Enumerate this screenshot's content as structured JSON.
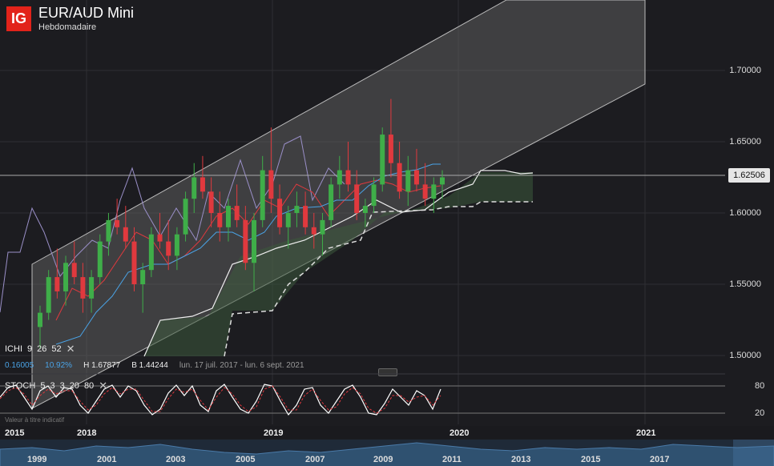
{
  "header": {
    "logo": "IG",
    "title": "EUR/AUD Mini",
    "subtitle": "Hebdomadaire"
  },
  "price_axis": {
    "ticks": [
      "1.70000",
      "1.65000",
      "1.60000",
      "1.55000",
      "1.50000"
    ],
    "current_price": "1.62506"
  },
  "ichimoku": {
    "label": "ICHI",
    "params": [
      "9",
      "26",
      "52"
    ],
    "close_icon": "close-icon",
    "change": "0.16005",
    "change_pct": "10.92%",
    "high": "H 1.67877",
    "low": "B 1.44244",
    "range": "lun. 17 juil. 2017 - lun. 6 sept. 2021"
  },
  "stochastic": {
    "label": "STOCH",
    "params": [
      "5",
      "3",
      "3",
      "20",
      "80"
    ],
    "close_icon": "close-icon",
    "note": "Valeur à titre indicatif",
    "levels": [
      "80",
      "20"
    ]
  },
  "time_axis": [
    "2015",
    "2018",
    "2019",
    "2020",
    "2021"
  ],
  "navigator_axis": [
    "1999",
    "2001",
    "2003",
    "2005",
    "2007",
    "2009",
    "2011",
    "2013",
    "2015",
    "2017"
  ],
  "colors": {
    "up": "#3fae49",
    "down": "#e0393e",
    "channel": "#8a8a8a",
    "cloud": "#3c4a3c",
    "tenkan": "#e0393e",
    "kijun": "#4aa3e6",
    "chikou": "#9a8fc8",
    "senkou": "#ffffff"
  },
  "chart_data": {
    "type": "candlestick",
    "period": "weekly",
    "ylim": [
      1.475,
      1.725
    ],
    "ohlc": [
      [
        1.52,
        1.535,
        1.505,
        1.53
      ],
      [
        1.53,
        1.56,
        1.525,
        1.555
      ],
      [
        1.555,
        1.575,
        1.54,
        1.545
      ],
      [
        1.545,
        1.57,
        1.535,
        1.565
      ],
      [
        1.565,
        1.58,
        1.55,
        1.555
      ],
      [
        1.555,
        1.565,
        1.53,
        1.54
      ],
      [
        1.54,
        1.56,
        1.53,
        1.555
      ],
      [
        1.555,
        1.585,
        1.55,
        1.58
      ],
      [
        1.58,
        1.6,
        1.57,
        1.595
      ],
      [
        1.595,
        1.61,
        1.585,
        1.59
      ],
      [
        1.59,
        1.605,
        1.575,
        1.58
      ],
      [
        1.58,
        1.59,
        1.545,
        1.55
      ],
      [
        1.55,
        1.565,
        1.53,
        1.56
      ],
      [
        1.56,
        1.59,
        1.555,
        1.585
      ],
      [
        1.585,
        1.6,
        1.575,
        1.58
      ],
      [
        1.58,
        1.595,
        1.56,
        1.57
      ],
      [
        1.57,
        1.59,
        1.56,
        1.585
      ],
      [
        1.585,
        1.615,
        1.58,
        1.61
      ],
      [
        1.61,
        1.635,
        1.6,
        1.625
      ],
      [
        1.625,
        1.64,
        1.61,
        1.615
      ],
      [
        1.615,
        1.625,
        1.59,
        1.6
      ],
      [
        1.6,
        1.615,
        1.58,
        1.59
      ],
      [
        1.59,
        1.61,
        1.58,
        1.605
      ],
      [
        1.605,
        1.62,
        1.59,
        1.595
      ],
      [
        1.595,
        1.605,
        1.56,
        1.565
      ],
      [
        1.565,
        1.6,
        1.545,
        1.595
      ],
      [
        1.595,
        1.64,
        1.59,
        1.63
      ],
      [
        1.63,
        1.66,
        1.6,
        1.61
      ],
      [
        1.61,
        1.62,
        1.585,
        1.59
      ],
      [
        1.59,
        1.605,
        1.575,
        1.6
      ],
      [
        1.6,
        1.615,
        1.59,
        1.605
      ],
      [
        1.605,
        1.615,
        1.585,
        1.59
      ],
      [
        1.59,
        1.6,
        1.575,
        1.585
      ],
      [
        1.585,
        1.6,
        1.57,
        1.595
      ],
      [
        1.595,
        1.625,
        1.59,
        1.62
      ],
      [
        1.62,
        1.64,
        1.61,
        1.63
      ],
      [
        1.63,
        1.65,
        1.615,
        1.62
      ],
      [
        1.62,
        1.63,
        1.595,
        1.6
      ],
      [
        1.6,
        1.61,
        1.59,
        1.605
      ],
      [
        1.605,
        1.625,
        1.6,
        1.62
      ],
      [
        1.62,
        1.66,
        1.615,
        1.655
      ],
      [
        1.655,
        1.68,
        1.625,
        1.635
      ],
      [
        1.635,
        1.65,
        1.61,
        1.615
      ],
      [
        1.615,
        1.64,
        1.605,
        1.63
      ],
      [
        1.63,
        1.645,
        1.615,
        1.62
      ],
      [
        1.62,
        1.635,
        1.605,
        1.61
      ],
      [
        1.61,
        1.625,
        1.6,
        1.62
      ],
      [
        1.62,
        1.63,
        1.61,
        1.625
      ]
    ],
    "ylabel": ""
  }
}
